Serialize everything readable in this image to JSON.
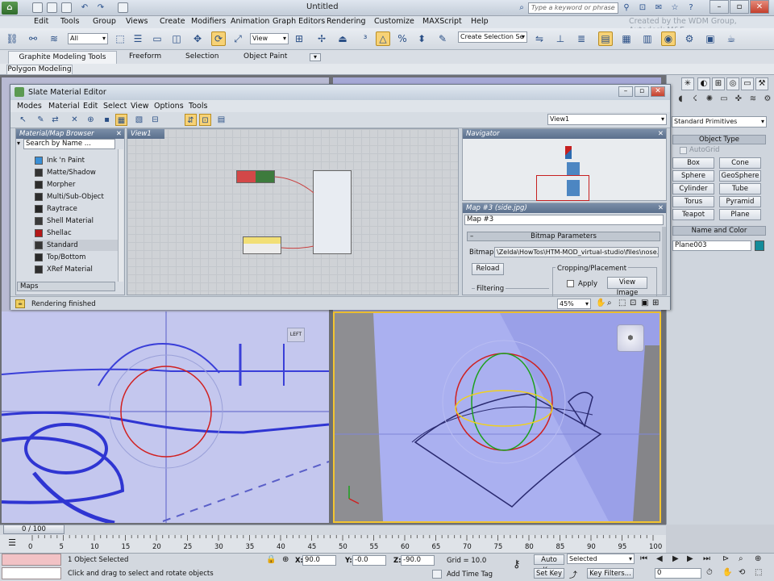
{
  "app": {
    "title": "Untitled",
    "search_placeholder": "Type a keyword or phrase",
    "credit": "Created by the WDM Group, Autodesk M&E"
  },
  "menubar": [
    "Edit",
    "Tools",
    "Group",
    "Views",
    "Create",
    "Modifiers",
    "Animation",
    "Graph Editors",
    "Rendering",
    "Customize",
    "MAXScript",
    "Help"
  ],
  "toolbar": {
    "selection_filter": "All",
    "reference_coord": "View",
    "named_selection": "Create Selection Se"
  },
  "ribbon": {
    "tabs": [
      "Graphite Modeling Tools",
      "Freeform",
      "Selection",
      "Object Paint"
    ],
    "sub_tab": "Polygon Modeling"
  },
  "slate": {
    "title": "Slate Material Editor",
    "menu": [
      "Modes",
      "Material",
      "Edit",
      "Select",
      "View",
      "Options",
      "Tools"
    ],
    "view_dropdown": "View1",
    "browser": {
      "title": "Material/Map Browser",
      "search_placeholder": "Search by Name ...",
      "items": [
        {
          "label": "Ink 'n Paint",
          "color": "#3a8fd6"
        },
        {
          "label": "Matte/Shadow",
          "color": "#333333"
        },
        {
          "label": "Morpher",
          "color": "#2c2c2c"
        },
        {
          "label": "Multi/Sub-Object",
          "color": "#2d2d2d"
        },
        {
          "label": "Raytrace",
          "color": "#262626"
        },
        {
          "label": "Shell Material",
          "color": "#3a3a3a"
        },
        {
          "label": "Shellac",
          "color": "#b41818"
        },
        {
          "label": "Standard",
          "color": "#353535"
        },
        {
          "label": "Top/Bottom",
          "color": "#2a2a2a"
        },
        {
          "label": "XRef Material",
          "color": "#2f2f2f"
        }
      ],
      "maps_label": "Maps"
    },
    "view_tab": "View1",
    "navigator_title": "Navigator",
    "params": {
      "title": "Map #3 (side.jpg)",
      "map_name": "Map #3",
      "section": "Bitmap Parameters",
      "bitmap_label": "Bitmap:",
      "bitmap_path": "\\Zelda\\HowTos\\HTM-MOD_virtual-studio\\files\\nose.jpg",
      "reload": "Reload",
      "cropping": "Cropping/Placement",
      "apply": "Apply",
      "view_image": "View Image",
      "filtering": "Filtering"
    },
    "status": "Rendering finished",
    "zoom": "45%"
  },
  "command_panel": {
    "dropdown": "Standard Primitives",
    "object_type_title": "Object Type",
    "autogrid": "AutoGrid",
    "primitives": [
      "Box",
      "Cone",
      "Sphere",
      "GeoSphere",
      "Cylinder",
      "Tube",
      "Torus",
      "Pyramid",
      "Teapot",
      "Plane"
    ],
    "name_color_title": "Name and Color",
    "object_name": "Plane003",
    "object_color": "#148c9a"
  },
  "timeline": {
    "slider": "0 / 100",
    "ticks": [
      "0",
      "5",
      "10",
      "15",
      "20",
      "25",
      "30",
      "35",
      "40",
      "45",
      "50",
      "55",
      "60",
      "65",
      "70",
      "75",
      "80",
      "85",
      "90",
      "95",
      "100"
    ]
  },
  "statusbar": {
    "selection": "1 Object Selected",
    "prompt": "Click and drag to select and rotate objects",
    "x_label": "X:",
    "x": "90.0",
    "y_label": "Y:",
    "y": "-0.0",
    "z_label": "Z:",
    "z": "-90.0",
    "grid": "Grid = 10.0",
    "add_time_tag": "Add Time Tag",
    "auto_key": "Auto Key",
    "set_key": "Set Key",
    "key_mode": "Selected",
    "key_filters": "Key Filters...",
    "frame": "0"
  }
}
